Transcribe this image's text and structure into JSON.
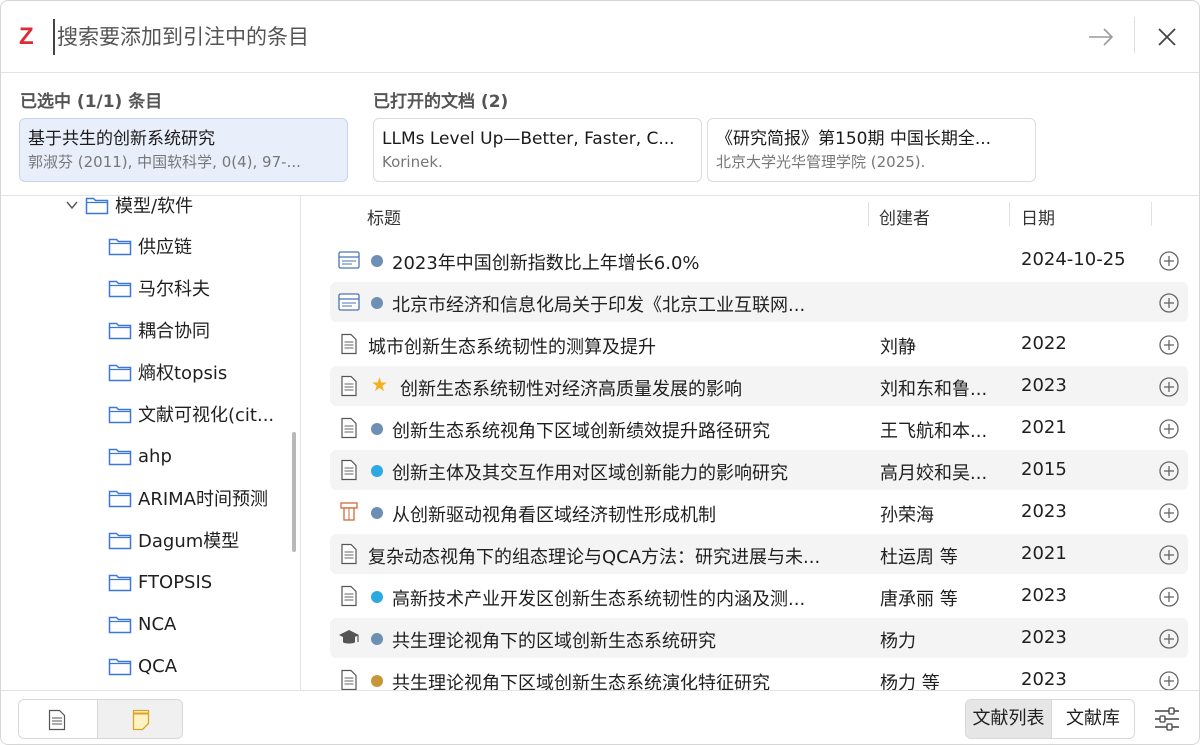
{
  "search": {
    "placeholder": "搜索要添加到引注中的条目"
  },
  "selected": {
    "heading": "已选中 (1/1) 条目",
    "item": {
      "title": "基于共生的创新系统研究",
      "subtitle": "郭淑芬 (2011), 中国软科学, 0(4), 97-..."
    }
  },
  "open_docs": {
    "heading": "已打开的文档 (2)",
    "items": [
      {
        "title": "LLMs Level Up—Better, Faster, C...",
        "subtitle": "Korinek."
      },
      {
        "title": "《研究简报》第150期 中国长期全...",
        "subtitle": "北京大学光华管理学院 (2025)."
      }
    ]
  },
  "sidebar": {
    "parent": "模型/软件",
    "items": [
      "供应链",
      "马尔科夫",
      "耦合协同",
      "熵权topsis",
      "文献可视化(cit...",
      "ahp",
      "ARIMA时间预测",
      "Dagum模型",
      "FTOPSIS",
      "NCA",
      "QCA"
    ]
  },
  "table": {
    "columns": {
      "title": "标题",
      "creator": "创建者",
      "date": "日期"
    },
    "rows": [
      {
        "icon": "webpage-icon",
        "marker": "dot",
        "color": "#6c8fb3",
        "title": "2023年中国创新指数比上年增长6.0%",
        "creator": "",
        "date": "2024-10-25"
      },
      {
        "icon": "webpage-icon",
        "marker": "dot",
        "color": "#6c8fb3",
        "title": "北京市经济和信息化局关于印发《北京工业互联网...",
        "creator": "",
        "date": ""
      },
      {
        "icon": "document-icon",
        "marker": "none",
        "color": "",
        "title": "城市创新生态系统韧性的测算及提升",
        "creator": "刘静",
        "date": "2022"
      },
      {
        "icon": "document-icon",
        "marker": "star",
        "color": "#f2b11b",
        "title": "创新生态系统韧性对经济高质量发展的影响",
        "creator": "刘和东和鲁...",
        "date": "2023"
      },
      {
        "icon": "document-icon",
        "marker": "dot",
        "color": "#6c8fb3",
        "title": "创新生态系统视角下区域创新绩效提升路径研究",
        "creator": "王飞航和本...",
        "date": "2021"
      },
      {
        "icon": "document-icon",
        "marker": "dot",
        "color": "#2da9e1",
        "title": "创新主体及其交互作用对区域创新能力的影响研究",
        "creator": "高月姣和吴...",
        "date": "2015"
      },
      {
        "icon": "conference-icon",
        "marker": "dot",
        "color": "#6c8fb3",
        "title": "从创新驱动视角看区域经济韧性形成机制",
        "creator": "孙荣海",
        "date": "2023"
      },
      {
        "icon": "document-icon",
        "marker": "none",
        "color": "",
        "title": "复杂动态视角下的组态理论与QCA方法：研究进展与未...",
        "creator": "杜运周 等",
        "date": "2021"
      },
      {
        "icon": "document-icon",
        "marker": "dot",
        "color": "#2da9e1",
        "title": "高新技术产业开发区创新生态系统韧性的内涵及测...",
        "creator": "唐承丽 等",
        "date": "2023"
      },
      {
        "icon": "thesis-icon",
        "marker": "dot",
        "color": "#6c8fb3",
        "title": "共生理论视角下的区域创新生态系统研究",
        "creator": "杨力",
        "date": "2023"
      },
      {
        "icon": "document-icon",
        "marker": "dot",
        "color": "#c9953a",
        "title": "共生理论视角下区域创新生态系统演化特征研究",
        "creator": "杨力 等",
        "date": "2023"
      }
    ]
  },
  "bottom": {
    "mode_list": "文献列表",
    "mode_library": "文献库"
  }
}
